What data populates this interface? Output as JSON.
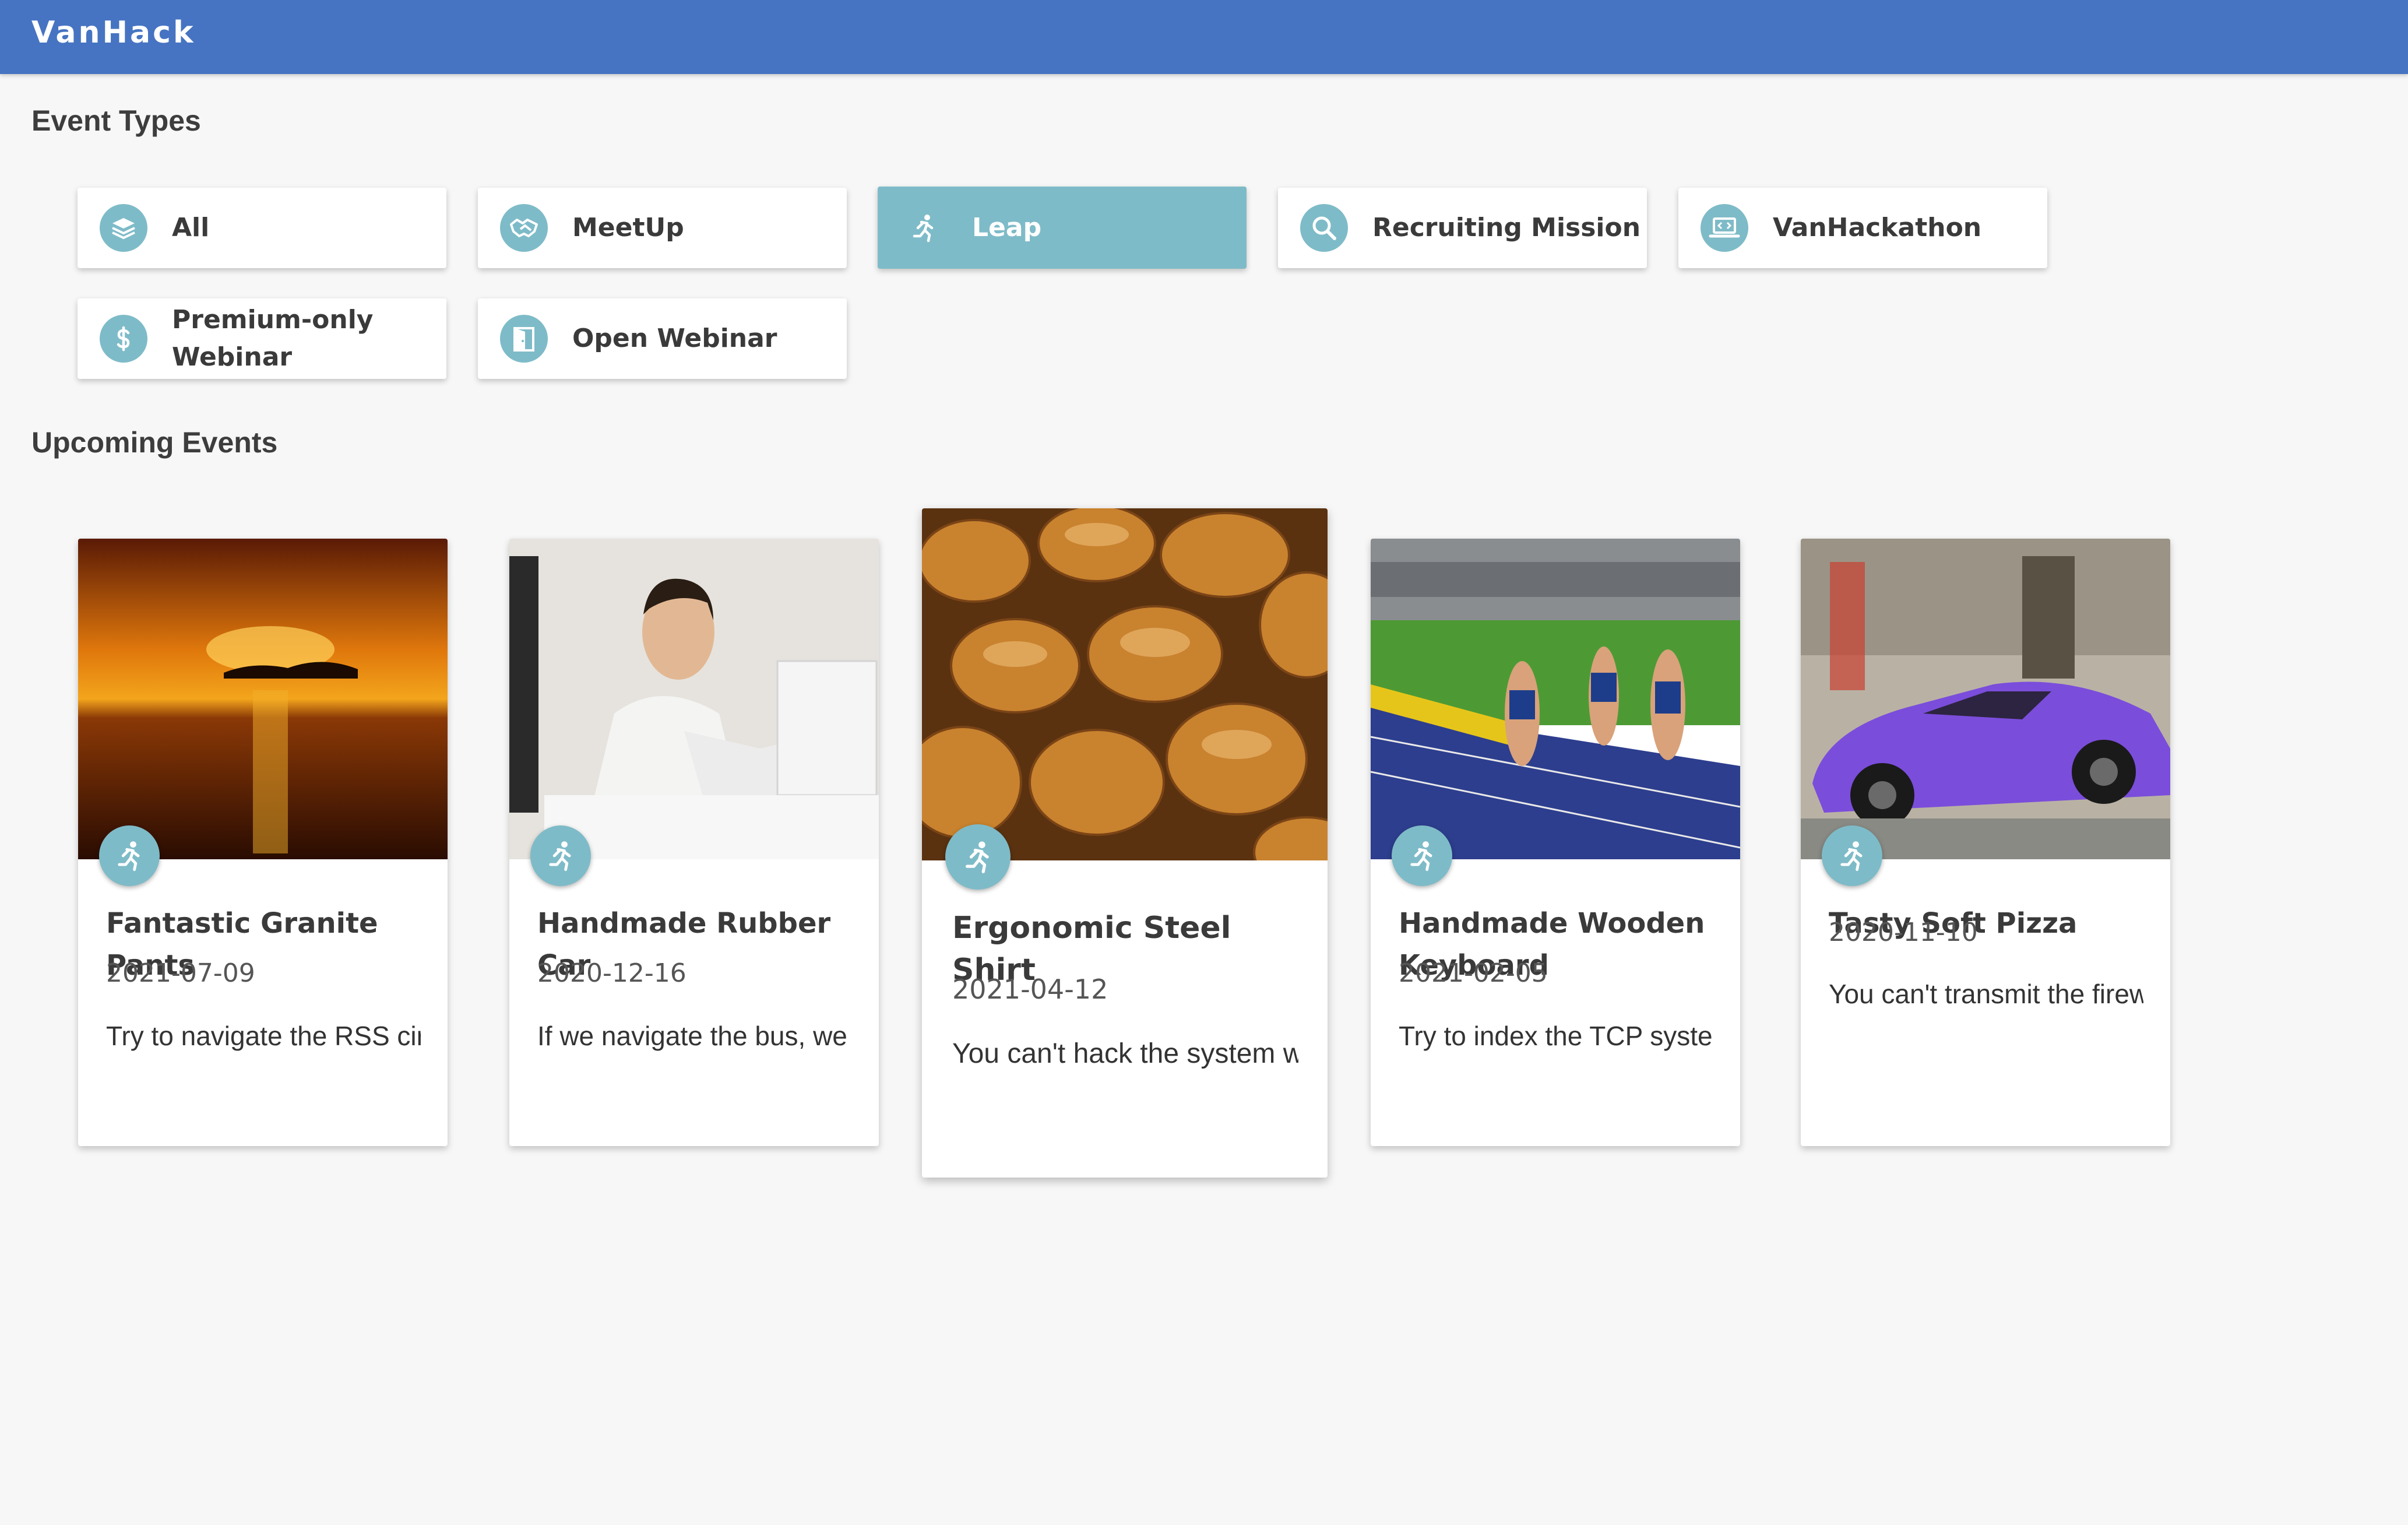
{
  "app": {
    "brand": "VanHack"
  },
  "sections": {
    "event_types": "Event Types",
    "upcoming_events": "Upcoming Events"
  },
  "theme": {
    "header_color": "#4674c2",
    "accent": "#7ebbc8",
    "background": "#f7f7f7"
  },
  "event_types": [
    {
      "label": "All",
      "icon": "layers-icon",
      "active": false
    },
    {
      "label": "MeetUp",
      "icon": "handshake-icon",
      "active": false
    },
    {
      "label": "Leap",
      "icon": "runner-icon",
      "active": true
    },
    {
      "label": "Recruiting Mission",
      "icon": "search-icon",
      "active": false
    },
    {
      "label": "VanHackathon",
      "icon": "laptop-code-icon",
      "active": false
    },
    {
      "label": "Premium-only Webinar",
      "icon": "dollar-icon",
      "active": false
    },
    {
      "label": "Open Webinar",
      "icon": "door-icon",
      "active": false
    }
  ],
  "events": [
    {
      "title": "Fantastic Granite Pants",
      "date": "2021-07-09",
      "description": "Try to navigate the RSS circuit",
      "image": "sunset-over-lake",
      "badge_icon": "runner-icon"
    },
    {
      "title": "Handmade Rubber Car",
      "date": "2020-12-16",
      "description": "If we navigate the bus, we can",
      "image": "man-on-phone-at-desk",
      "badge_icon": "runner-icon"
    },
    {
      "title": "Ergonomic Steel Shirt",
      "date": "2021-04-12",
      "description": "You can't hack the system without",
      "image": "bread-rolls",
      "badge_icon": "runner-icon",
      "highlighted": true
    },
    {
      "title": "Handmade Wooden Keyboard",
      "date": "2021-02-05",
      "description": "Try to index the TCP system",
      "image": "women-sprinting-on-track",
      "badge_icon": "runner-icon"
    },
    {
      "title": "Tasty Soft Pizza",
      "date": "2020-11-10",
      "description": "You can't transmit the firewall",
      "image": "purple-sports-car",
      "badge_icon": "runner-icon"
    }
  ]
}
